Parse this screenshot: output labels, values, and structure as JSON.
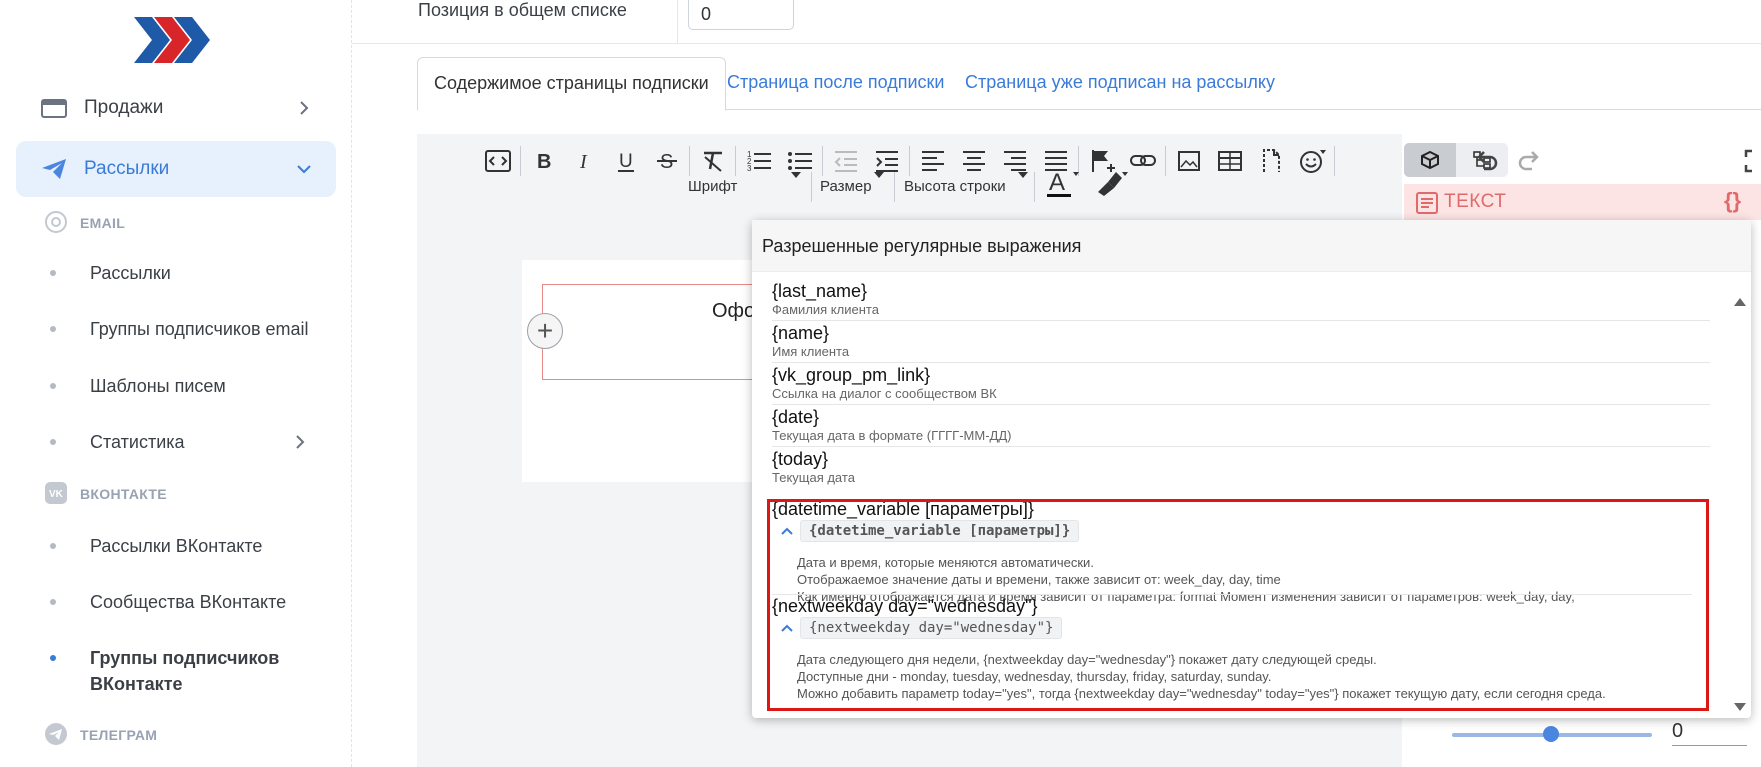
{
  "sidebar": {
    "items": [
      {
        "label": "Продажи",
        "icon": "wallet-icon"
      },
      {
        "label": "Рассылки",
        "icon": "paper-plane-icon"
      }
    ],
    "sections": [
      {
        "title": "EMAIL",
        "icon": "at-icon"
      },
      {
        "title": "ВКОНТАКТЕ",
        "icon": "vk-icon"
      },
      {
        "title": "ТЕЛЕГРАМ",
        "icon": "telegram-icon"
      }
    ],
    "email_items": [
      "Рассылки",
      "Группы подписчиков email",
      "Шаблоны писем",
      "Статистика"
    ],
    "vk_items": [
      "Рассылки ВКонтакте",
      "Сообщества ВКонтакте",
      "Группы подписчиков ВКонтакте"
    ]
  },
  "main": {
    "position_label": "Позиция в общем списке",
    "position_value": "0",
    "tabs": [
      {
        "label": "Содержимое страницы подписки",
        "active": true
      },
      {
        "label": "Страница после подписки",
        "active": false
      },
      {
        "label": "Страница уже подписан на рассылку",
        "active": false
      }
    ],
    "format": {
      "font": "Шрифт",
      "size": "Размер",
      "line_height": "Высота строки"
    },
    "canvas_text": "Офо",
    "right_panel": {
      "text_label": "ТЕКСТ",
      "braces": "{}",
      "slider_value": "0"
    }
  },
  "popup": {
    "title": "Разрешенные регулярные выражения",
    "variables": [
      {
        "name": "{last_name}",
        "desc": "Фамилия клиента"
      },
      {
        "name": "{name}",
        "desc": "Имя клиента"
      },
      {
        "name": "{vk_group_pm_link}",
        "desc": "Ссылка на диалог с сообществом ВК"
      },
      {
        "name": "{date}",
        "desc": "Текущая дата в формате (ГГГГ-ММ-ДД)"
      },
      {
        "name": "{today}",
        "desc": "Текущая дата"
      }
    ],
    "expanded": [
      {
        "name": "{datetime_variable [параметры]}",
        "code": "{datetime_variable [параметры]}",
        "lines": [
          "Дата и время, которые меняются автоматически.",
          "Отображаемое значение даты и времени, также зависит от: week_day, day, time",
          "Как именно отображается дата и время зависит от параметра: format Момент изменения зависит от параметров: week_day, day,"
        ]
      },
      {
        "name": "{nextweekday day=\"wednesday\"}",
        "code": "{nextweekday day=\"wednesday\"}",
        "lines": [
          "Дата следующего дня недели, {nextweekday day=\"wednesday\"} покажет дату следующей среды.",
          "Доступные дни - monday, tuesday, wednesday, thursday, friday, saturday, sunday.",
          "Можно добавить параметр today=\"yes\", тогда {nextweekday day=\"wednesday\" today=\"yes\"} покажет текущую дату, если сегодня среда."
        ]
      }
    ]
  },
  "colors": {
    "accent": "#3b7bd8",
    "highlight": "#dd1616",
    "text_bar": "#fde4e4"
  }
}
